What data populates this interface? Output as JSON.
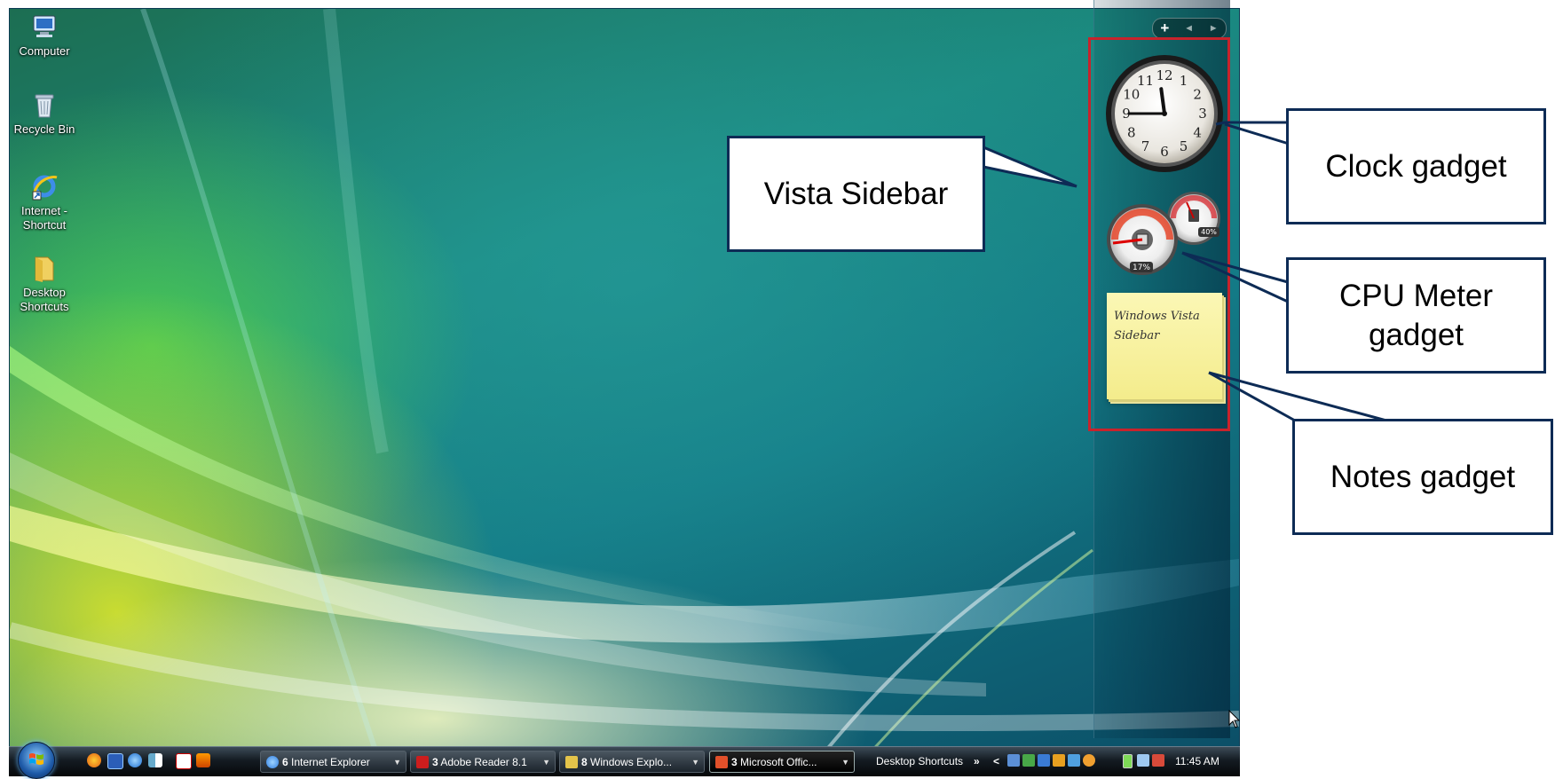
{
  "desktop": {
    "icons": [
      {
        "label": "Computer",
        "icon": "computer-icon"
      },
      {
        "label": "Recycle Bin",
        "icon": "recycle-bin-icon"
      },
      {
        "label": "Internet - Shortcut",
        "icon": "internet-explorer-icon"
      },
      {
        "label": "Desktop Shortcuts",
        "icon": "folder-icon"
      }
    ]
  },
  "sidebar": {
    "controls": {
      "add": "+",
      "prev": "◄",
      "next": "►"
    },
    "clock": {
      "hours": "12 1 2 3 4 5 6 7 8 9 10 11",
      "time_hour": 11,
      "time_minute": 45
    },
    "cpu_meter": {
      "cpu": "17%",
      "memory": "40%"
    },
    "note": {
      "line1": "Windows Vista",
      "line2": "Sidebar"
    }
  },
  "callouts": {
    "sidebar": "Vista Sidebar",
    "clock": "Clock gadget",
    "cpu_line1": "CPU Meter",
    "cpu_line2": "gadget",
    "notes": "Notes gadget"
  },
  "taskbar": {
    "tasks": [
      {
        "count": "6",
        "label": "Internet Explorer",
        "color": "#2e7de0"
      },
      {
        "count": "3",
        "label": "Adobe Reader 8.1",
        "color": "#cc1d1d"
      },
      {
        "count": "8",
        "label": "Windows Explo...",
        "color": "#e4c44a"
      },
      {
        "count": "3",
        "label": "Microsoft Offic...",
        "color": "#e2502a"
      }
    ],
    "toolbar_label": "Desktop Shortcuts",
    "toolbar_more": "»",
    "tray_expand": "<",
    "clock": "11:45 AM"
  },
  "colors": {
    "highlight_box": "#c8232c",
    "callout_border": "#0d2b55"
  }
}
